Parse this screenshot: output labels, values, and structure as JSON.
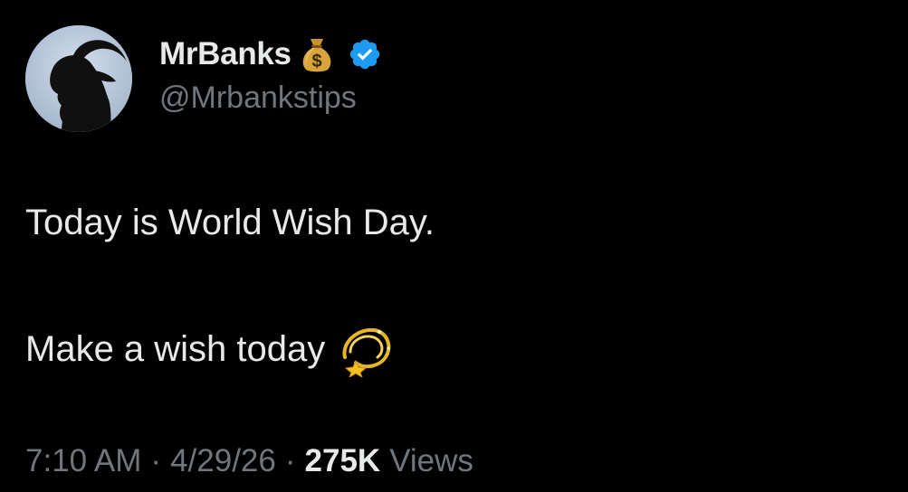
{
  "author": {
    "display_name": "MrBanks",
    "name_emoji": "money-bag-icon",
    "verified": true,
    "handle": "@Mrbankstips"
  },
  "tweet": {
    "lines": [
      "Today is World Wish Day.",
      "Make a wish today"
    ],
    "trailing_emoji": "dizzy-star-icon"
  },
  "meta": {
    "time": "7:10 AM",
    "separator": "·",
    "date": "4/29/26",
    "views_count": "275K",
    "views_label": "Views"
  },
  "colors": {
    "background": "#000000",
    "primary_text": "#e7e9ea",
    "secondary_text": "#71767b",
    "verified_blue": "#1d9bf0"
  }
}
